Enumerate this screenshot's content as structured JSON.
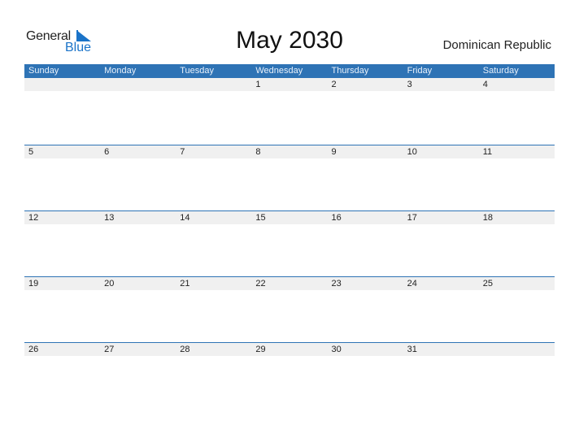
{
  "logo": {
    "text_general": "General",
    "text_blue": "Blue",
    "icon": "triangle-flag-icon"
  },
  "title": "May 2030",
  "country": "Dominican Republic",
  "colors": {
    "accent": "#2e73b5",
    "strip": "#f0f0f0",
    "logo_blue": "#1a73c8"
  },
  "weekdays": [
    "Sunday",
    "Monday",
    "Tuesday",
    "Wednesday",
    "Thursday",
    "Friday",
    "Saturday"
  ],
  "weeks": [
    [
      "",
      "",
      "",
      "1",
      "2",
      "3",
      "4"
    ],
    [
      "5",
      "6",
      "7",
      "8",
      "9",
      "10",
      "11"
    ],
    [
      "12",
      "13",
      "14",
      "15",
      "16",
      "17",
      "18"
    ],
    [
      "19",
      "20",
      "21",
      "22",
      "23",
      "24",
      "25"
    ],
    [
      "26",
      "27",
      "28",
      "29",
      "30",
      "31",
      ""
    ]
  ]
}
